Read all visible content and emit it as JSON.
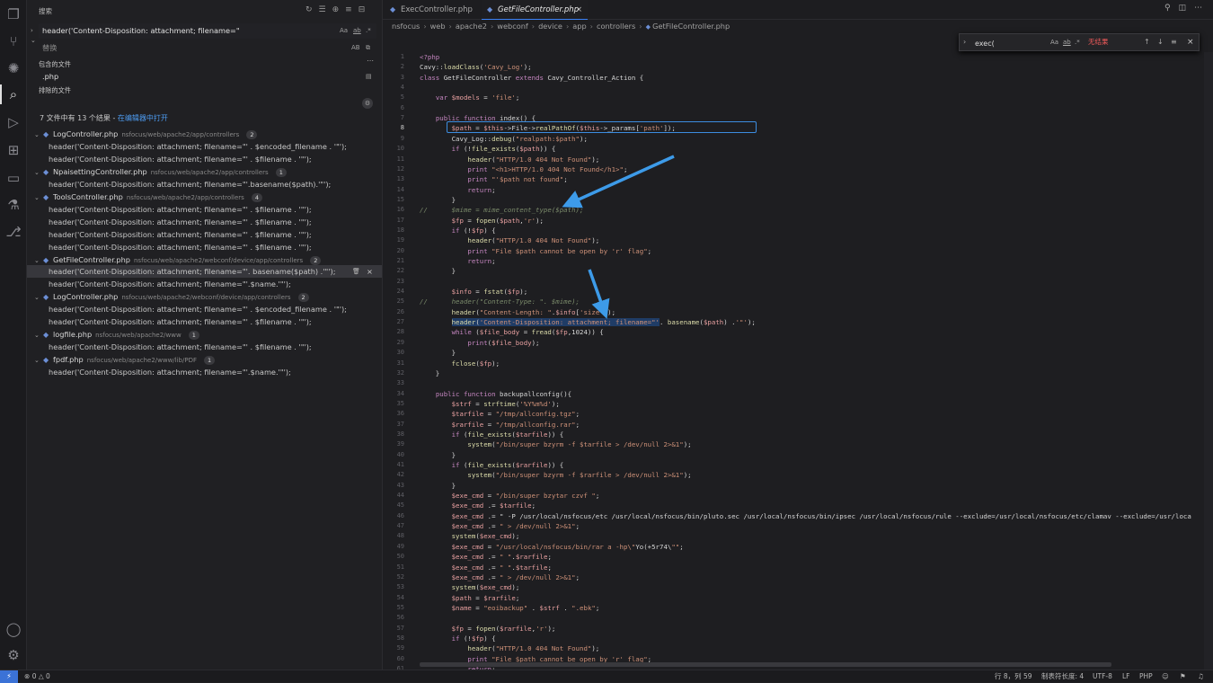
{
  "activity_bar": {
    "items": [
      {
        "name": "explorer-icon",
        "glyph": "❐"
      },
      {
        "name": "source-control-icon",
        "glyph": "⑂"
      },
      {
        "name": "copilot-icon",
        "glyph": "✺"
      },
      {
        "name": "search-icon",
        "glyph": "⌕"
      },
      {
        "name": "run-debug-icon",
        "glyph": "▷"
      },
      {
        "name": "extensions-icon",
        "glyph": "⊞"
      },
      {
        "name": "remote-explorer-icon",
        "glyph": "▭"
      },
      {
        "name": "testing-icon",
        "glyph": "⚗"
      },
      {
        "name": "git-graph-icon",
        "glyph": "⎇"
      }
    ],
    "bottom": [
      {
        "name": "account-icon",
        "glyph": "◯"
      },
      {
        "name": "settings-gear-icon",
        "glyph": "⚙"
      }
    ]
  },
  "search": {
    "title": "搜索",
    "query": "header('Content-Disposition: attachment; filename=\"",
    "opt_case": "Aa",
    "opt_word": "ab",
    "opt_regex": ".*",
    "replace_placeholder": "替换",
    "replace_opt": "AB",
    "include_label": "包含的文件",
    "include_value": ".php",
    "exclude_label": "排除的文件",
    "summary_prefix": "7 文件中有 13 个结果 - ",
    "summary_link": "在编辑器中打开"
  },
  "results": [
    {
      "file": "LogController.php",
      "path": "nsfocus/web/apache2/app/controllers",
      "count": "2",
      "lines": [
        "header('Content-Disposition: attachment; filename=\"' . $encoded_filename . '\"');",
        "header('Content-Disposition: attachment; filename=\"' . $filename . '\"');"
      ]
    },
    {
      "file": "NpaisettingController.php",
      "path": "nsfocus/web/apache2/app/controllers",
      "count": "1",
      "lines": [
        "header('Content-Disposition: attachment; filename=\"'.basename($path).'\"');"
      ]
    },
    {
      "file": "ToolsController.php",
      "path": "nsfocus/web/apache2/app/controllers",
      "count": "4",
      "lines": [
        "header('Content-Disposition: attachment; filename=\"' . $filename . '\"');",
        "header('Content-Disposition: attachment; filename=\"' . $filename . '\"');",
        "header('Content-Disposition: attachment; filename=\"' . $filename . '\"');",
        "header('Content-Disposition: attachment; filename=\"' . $filename . '\"');"
      ]
    },
    {
      "file": "GetFileController.php",
      "path": "nsfocus/web/apache2/webconf/device/app/controllers",
      "count": "2",
      "lines": [
        "header('Content-Disposition: attachment; filename=\"'. basename($path) .'\"');",
        "header('Content-Disposition: attachment; filename=\"'.$name.'\"');"
      ]
    },
    {
      "file": "LogController.php",
      "path": "nsfocus/web/apache2/webconf/device/app/controllers",
      "count": "2",
      "lines": [
        "header('Content-Disposition: attachment; filename=\"' . $encoded_filename . '\"');",
        "header('Content-Disposition: attachment; filename=\"' . $filename . '\"');"
      ]
    },
    {
      "file": "logfile.php",
      "path": "nsfocus/web/apache2/www",
      "count": "1",
      "lines": [
        "header('Content-Disposition: attachment; filename=\"' . $filename . '\"');"
      ]
    },
    {
      "file": "fpdf.php",
      "path": "nsfocus/web/apache2/www/lib/PDF",
      "count": "1",
      "lines": [
        "header('Content-Disposition: attachment; filename=\"'.$name.'\"');"
      ]
    }
  ],
  "tabs": [
    {
      "label": "ExecController.php",
      "active": false
    },
    {
      "label": "GetFileController.php",
      "active": true
    }
  ],
  "breadcrumb": [
    "nsfocus",
    "web",
    "apache2",
    "webconf",
    "device",
    "app",
    "controllers",
    "GetFileController.php"
  ],
  "find_widget": {
    "query": "exec(",
    "opt_case": "Aa",
    "opt_word": "ab",
    "opt_regex": ".*",
    "no_results": "无结果"
  },
  "editor": {
    "start_line": 1,
    "current_line": 8,
    "lines": [
      "<?php",
      "Cavy::loadClass('Cavy_Log');",
      "class GetFileController extends Cavy_Controller_Action {",
      "",
      "    var $models = 'file';",
      "",
      "    public function index() {",
      "        $path = $this->File->realPathOf($this->_params['path']);",
      "        Cavy_Log::debug(\"realpath:$path\");",
      "        if (!file_exists($path)) {",
      "            header(\"HTTP/1.0 404 Not Found\");",
      "            print \"<h1>HTTP/1.0 404 Not Found</h1>\";",
      "            print \"'$path not found\";",
      "            return;",
      "        }",
      "//      $mime = mime_content_type($path);",
      "        $fp = fopen($path,'r');",
      "        if (!$fp) {",
      "            header(\"HTTP/1.0 404 Not Found\");",
      "            print \"File $path cannot be open by 'r' flag\";",
      "            return;",
      "        }",
      "",
      "        $info = fstat($fp);",
      "//      header(\"Content-Type: \". $mime);",
      "        header(\"Content-Length: \".$info['size']);",
      "        header('Content-Disposition: attachment; filename=\"'. basename($path) .'\"');",
      "        while ($file_body = fread($fp,1024)) {",
      "            print($file_body);",
      "        }",
      "        fclose($fp);",
      "    }",
      "",
      "    public function backupallconfig(){",
      "        $strf = strftime('%Y%m%d');",
      "        $tarfile = \"/tmp/allconfig.tgz\";",
      "        $rarfile = \"/tmp/allconfig.rar\";",
      "        if (file_exists($tarfile)) {",
      "            system(\"/bin/super bzyrm -f $tarfile > /dev/null 2>&1\");",
      "        }",
      "        if (file_exists($rarfile)) {",
      "            system(\"/bin/super bzyrm -f $rarfile > /dev/null 2>&1\");",
      "        }",
      "        $exe_cmd = \"/bin/super bzytar czvf \";",
      "        $exe_cmd .= $tarfile;",
      "        $exe_cmd .= \" -P /usr/local/nsfocus/etc /usr/local/nsfocus/bin/pluto.sec /usr/local/nsfocus/bin/ipsec /usr/local/nsfocus/rule --exclude=/usr/local/nsfocus/etc/clamav --exclude=/usr/loca",
      "        $exe_cmd .= \" > /dev/null 2>&1\";",
      "        system($exe_cmd);",
      "        $exe_cmd = \"/usr/local/nsfocus/bin/rar a -hp\\\"Yo(+5r74\\\"\";",
      "        $exe_cmd .= \" \".$rarfile;",
      "        $exe_cmd .= \" \".$tarfile;",
      "        $exe_cmd .= \" > /dev/null 2>&1\";",
      "        system($exe_cmd);",
      "        $path = $rarfile;",
      "        $name = \"eoibackup\" . $strf . \".ebk\";",
      "",
      "        $fp = fopen($rarfile,'r');",
      "        if (!$fp) {",
      "            header(\"HTTP/1.0 404 Not Found\");",
      "            print \"File $path cannot be open by 'r' flag\";",
      "            return;"
    ]
  },
  "status": {
    "remote_icon": "⚡",
    "errors": "0",
    "warnings": "0",
    "position": "行 8，列 59",
    "tab_size": "制表符长度: 4",
    "encoding": "UTF-8",
    "eol": "LF",
    "language": "PHP"
  },
  "colors": {
    "accent": "#3b82f6",
    "keyword": "#c586c0",
    "string": "#ce9178"
  }
}
